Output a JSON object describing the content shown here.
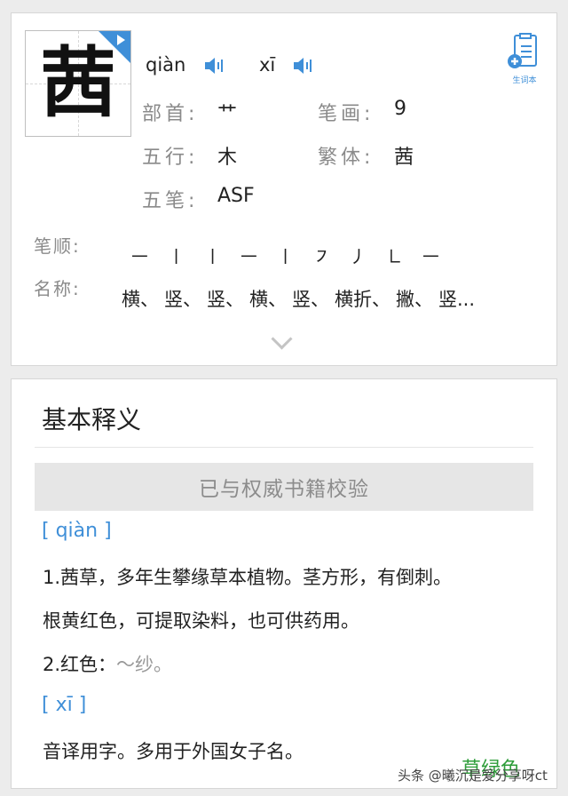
{
  "entry": {
    "character": "茜",
    "pinyin": [
      "qiàn",
      "xī"
    ],
    "vocab_label": "生词本",
    "fields": [
      {
        "label": "部首:",
        "value": "艹"
      },
      {
        "label": "笔画:",
        "value": "9"
      },
      {
        "label": "五行:",
        "value": "木"
      },
      {
        "label": "繁体:",
        "value": "茜"
      },
      {
        "label": "五笔:",
        "value": "ASF"
      }
    ],
    "stroke_order_label": "笔顺:",
    "strokes": [
      "㇐",
      "㇑",
      "㇑",
      "㇐",
      "㇑",
      "㇇",
      "㇓",
      "㇗",
      "㇐"
    ],
    "stroke_names_label": "名称:",
    "stroke_names": [
      "横、",
      "竖、",
      "竖、",
      "横、",
      "竖、",
      "横折、",
      "撇、",
      "竖..."
    ]
  },
  "basic": {
    "title": "基本释义",
    "verify_text": "已与权威书籍校验",
    "readings": [
      {
        "pinyin": "[ qiàn ]",
        "lines": [
          {
            "text": "1.茜草，多年生攀缘草本植物。茎方形，有倒刺。",
            "example": ""
          },
          {
            "text": "根黄红色，可提取染料，也可供药用。",
            "example": ""
          },
          {
            "text": "2.红色：",
            "example": "～纱。"
          }
        ]
      },
      {
        "pinyin": "[ xī ]",
        "lines": [
          {
            "text": "音译用字。多用于外国女子名。",
            "example": ""
          }
        ]
      }
    ]
  },
  "overlay": {
    "watermark": "头条 @曦沉是爱分享呀ct",
    "color_word": "草绿色"
  },
  "colors": {
    "accent": "#3f8fd8",
    "label": "#8a8a8a",
    "green": "#2e9d3a"
  }
}
